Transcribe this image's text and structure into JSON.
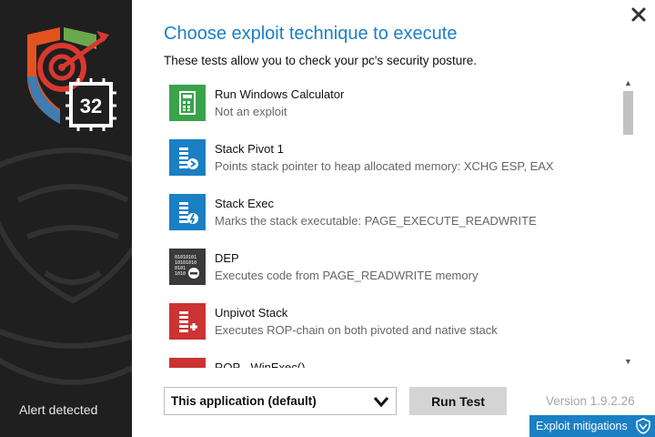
{
  "sidebar": {
    "badge_number": "32",
    "status_text": "Alert detected"
  },
  "main": {
    "title": "Choose exploit technique to execute",
    "subtitle": "These tests allow you to check your pc's security posture."
  },
  "tests": [
    {
      "name": "Run Windows Calculator",
      "desc": "Not an exploit",
      "icon": "calculator-icon",
      "color": "#3aa24a"
    },
    {
      "name": "Stack Pivot 1",
      "desc": "Points stack pointer to heap allocated memory: XCHG ESP, EAX",
      "icon": "stack-pivot-icon",
      "color": "#1b7fc4"
    },
    {
      "name": "Stack Exec",
      "desc": "Marks the stack executable: PAGE_EXECUTE_READWRITE",
      "icon": "stack-exec-icon",
      "color": "#1b7fc4"
    },
    {
      "name": "DEP",
      "desc": "Executes code from PAGE_READWRITE memory",
      "icon": "dep-icon",
      "color": "#3a3a3a"
    },
    {
      "name": "Unpivot Stack",
      "desc": "Executes ROP-chain on both pivoted and native stack",
      "icon": "unpivot-icon",
      "color": "#cc3333"
    },
    {
      "name": "ROP - WinExec()",
      "desc": "",
      "icon": "rop-icon",
      "color": "#cc3333"
    }
  ],
  "footer": {
    "target_select": "This application (default)",
    "run_label": "Run Test",
    "version": "Version 1.9.2.26",
    "mitigations_label": "Exploit mitigations"
  },
  "colors": {
    "accent": "#1b7fc4",
    "sidebar_bg": "#1f1f1f",
    "green": "#3aa24a",
    "red": "#cc3333",
    "dark": "#3a3a3a"
  }
}
